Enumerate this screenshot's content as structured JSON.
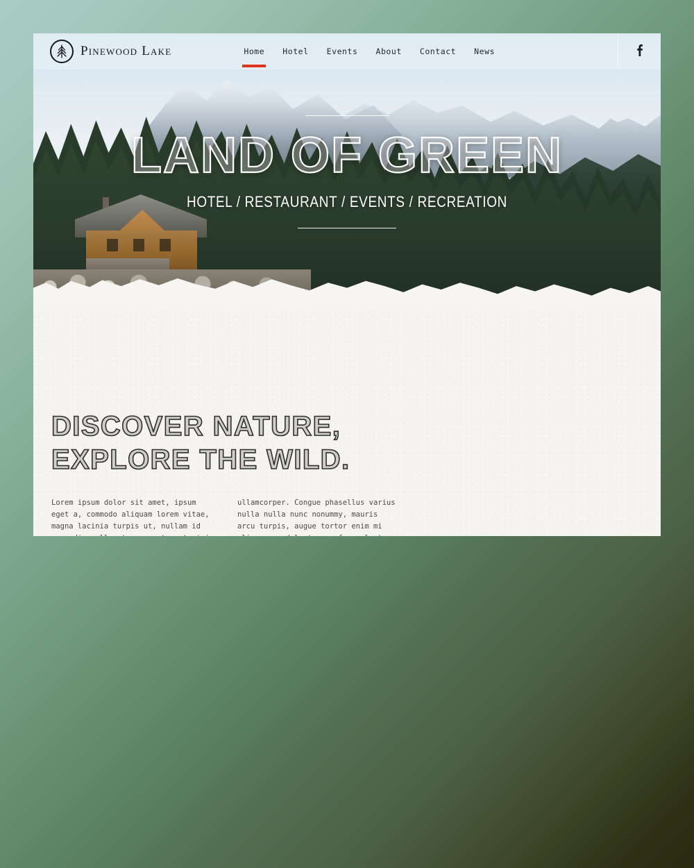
{
  "site": {
    "brand_name": "Pinewood Lake",
    "logo_icon": "pine-tree-in-circle-icon"
  },
  "header": {
    "nav": [
      {
        "label": "Home",
        "active": true
      },
      {
        "label": "Hotel",
        "active": false
      },
      {
        "label": "Events",
        "active": false
      },
      {
        "label": "About",
        "active": false
      },
      {
        "label": "Contact",
        "active": false
      },
      {
        "label": "News",
        "active": false
      }
    ],
    "social": {
      "icon": "facebook-icon",
      "label": "f"
    },
    "active_indicator_color": "#e0331e"
  },
  "hero": {
    "title": "LAND OF GREEN",
    "subtitle": "HOTEL / RESTAURANT / EVENTS / RECREATION"
  },
  "intro": {
    "title_line1": "DISCOVER NATURE,",
    "title_line2": "EXPLORE THE WILD.",
    "column_left": "Lorem ipsum dolor sit amet, ipsum eget a, commodo aliquam lorem vitae, magna lacinia turpis ut, nullam id non odio nulla at, eu auctor ut nisi at sed.",
    "column_right": "ullamcorper. Congue phasellus varius nulla nulla nunc nonummy, mauris arcu turpis, augue tortor enim mi aliquam, sed lectus ac fames luctus tellus."
  },
  "theme": {
    "page_background_top": "#a9cec5",
    "page_background_bottom": "#2a2b10",
    "content_background": "#f5f4f0",
    "accent": "#e0331e"
  }
}
